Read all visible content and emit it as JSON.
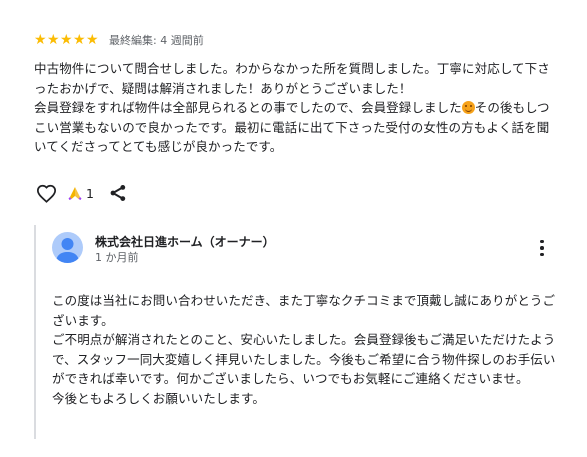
{
  "review": {
    "rating_stars": 5,
    "star_glyph": "★",
    "edited": "最終編集: 4 週間前",
    "text_line1": "中古物件について問合せしました。わからなかった所を質問しました。丁寧に対応して下さったおかげで、疑問は解消されました！ありがとうございました！",
    "text_line2a": "会員登録をすれば物件は全部見られるとの事でしたので、会員登録しました",
    "emoji": "grinning-face-emoji",
    "text_line2b": "その後もしつこい営業もないので良かったです。最初に電話に出て下さった受付の女性の方もよく話を聞いてくださってとても感じが良かったです。"
  },
  "actions": {
    "like_icon": "heart-outline-icon",
    "reaction_icon": "praying-hands-icon",
    "reaction_count": "1",
    "share_icon": "share-icon"
  },
  "owner_reply": {
    "name": "株式会社日進ホーム（オーナー）",
    "time": "1 か月前",
    "menu_icon": "more-vert-icon",
    "paragraph1": "この度は当社にお問い合わせいただき、また丁寧なクチコミまで頂戴し誠にありがとうございます。",
    "paragraph2": "ご不明点が解消されたとのこと、安心いたしました。会員登録後もご満足いただけたようで、スタッフ一同大変嬉しく拝見いたしました。今後もご希望に合う物件探しのお手伝いができれば幸いです。何かございましたら、いつでもお気軽にご連絡くださいませ。",
    "paragraph3": "今後ともよろしくお願いいたします。"
  },
  "colors": {
    "star": "#fbbc04",
    "avatar": "#aecbfa",
    "avatar_figure": "#4285f4",
    "secondary_text": "#5f6368",
    "divider": "#dadce0"
  }
}
